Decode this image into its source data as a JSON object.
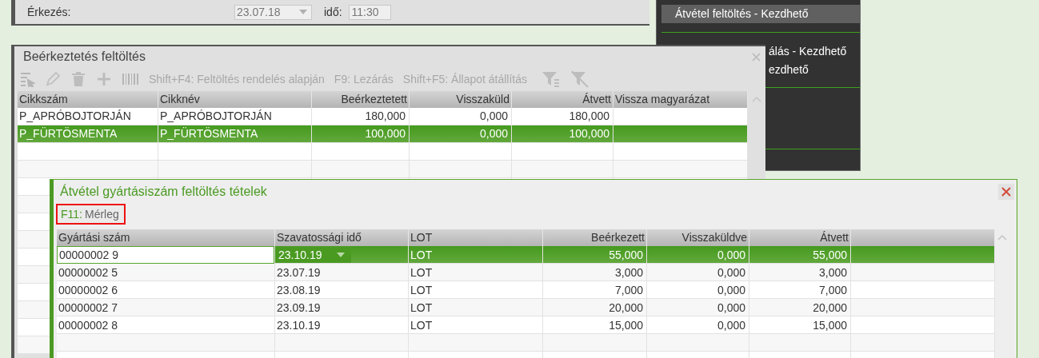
{
  "arrival_window": {
    "label": "Érkezés:",
    "date": "23.07.18",
    "time_label": "idő:",
    "time": "11:30"
  },
  "task_panel": {
    "groups": [
      {
        "items": [
          {
            "label": "Átvétel feltöltés - Kezdhető",
            "selected": true
          }
        ]
      },
      {
        "items": [
          {
            "label": "álás - Kezdhető",
            "selected": false
          },
          {
            "label": "ezdhető",
            "selected": false
          }
        ]
      }
    ]
  },
  "receipt_window": {
    "title": "Beérkeztetés feltöltés",
    "commands": [
      {
        "key": "Shift+F4:",
        "label": "Feltöltés rendelés alapján",
        "disabled": true
      },
      {
        "key": "F9:",
        "label": "Lezárás",
        "disabled": true
      },
      {
        "key": "Shift+F5:",
        "label": "Állapot átállítás",
        "disabled": true
      }
    ],
    "table": {
      "columns": [
        {
          "label": "Cikkszám",
          "kind": "text"
        },
        {
          "label": "Cikknév",
          "kind": "text"
        },
        {
          "label": "Beérkeztetett",
          "kind": "number"
        },
        {
          "label": "Visszaküld",
          "kind": "number"
        },
        {
          "label": "Átvett",
          "kind": "number"
        },
        {
          "label": "Vissza magyarázat",
          "kind": "text"
        }
      ],
      "rows": [
        {
          "cells": [
            "P_APRÓBOJTORJÁN",
            "P_APRÓBOJTORJÁN",
            "180,000",
            "0,000",
            "180,000",
            null
          ],
          "selected": false
        },
        {
          "cells": [
            "P_FÜRTÖSMENTA",
            "P_FÜRTÖSMENTA",
            "100,000",
            "0,000",
            "100,000",
            null
          ],
          "selected": true
        }
      ]
    }
  },
  "batch_window": {
    "title": "Átvétel gyártásiszám feltöltés tételek",
    "command": {
      "key": "F11:",
      "label": "Mérleg",
      "highlighted": true
    },
    "table": {
      "columns": [
        {
          "label": "Gyártási szám",
          "kind": "text"
        },
        {
          "label": "Szavatossági idő",
          "kind": "text"
        },
        {
          "label": "LOT",
          "kind": "text"
        },
        {
          "label": "Beérkezett",
          "kind": "number"
        },
        {
          "label": "Visszaküldve",
          "kind": "number"
        },
        {
          "label": "Átvett",
          "kind": "number"
        },
        {
          "kind": "text"
        }
      ],
      "rows": [
        {
          "cells": [
            "00000002 9",
            "23.10.19",
            "LOT",
            "55,000",
            "0,000",
            "55,000",
            null
          ],
          "selected": true,
          "editing": true
        },
        {
          "cells": [
            "00000002 5",
            "23.07.19",
            "LOT",
            "3,000",
            "0,000",
            "3,000",
            null
          ],
          "selected": false,
          "editing": false
        },
        {
          "cells": [
            "00000002 6",
            "23.08.19",
            "LOT",
            "7,000",
            "0,000",
            "7,000",
            null
          ],
          "selected": false,
          "editing": false
        },
        {
          "cells": [
            "00000002 7",
            "23.09.19",
            "LOT",
            "20,000",
            "0,000",
            "20,000",
            null
          ],
          "selected": false,
          "editing": false
        },
        {
          "cells": [
            "00000002 8",
            "23.10.19",
            "LOT",
            "15,000",
            "0,000",
            "15,000",
            null
          ],
          "selected": false,
          "editing": false
        }
      ]
    }
  }
}
